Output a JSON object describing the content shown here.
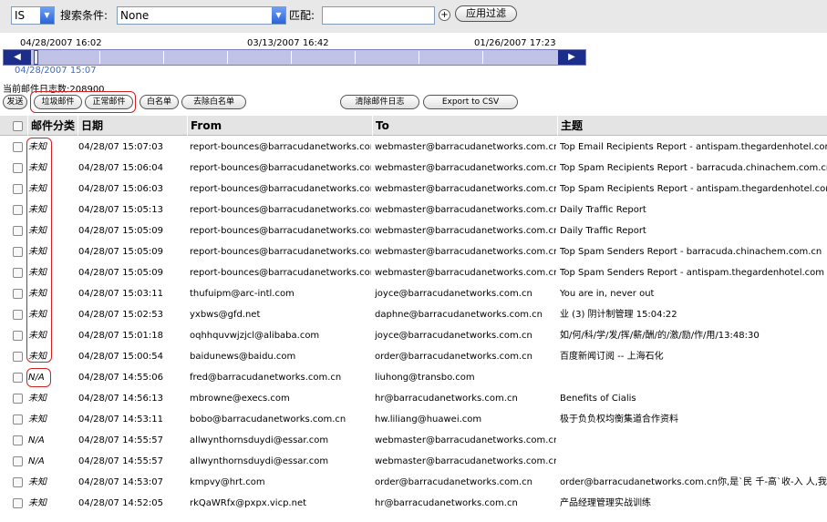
{
  "filter": {
    "field_value": "IS",
    "search_label": "搜索条件:",
    "condition_value": "None",
    "match_label": "匹配:",
    "match_text": "",
    "plus": "+",
    "apply_label": "应用过滤"
  },
  "timeline": {
    "start_date": "04/28/2007 16:02",
    "mid_date": "03/13/2007 16:42",
    "end_date": "01/26/2007 17:23",
    "current": "04/28/2007 15:07",
    "left_arrow": "◀",
    "right_arrow": "▶"
  },
  "total_label": "当前邮件日志数:208900",
  "actions": {
    "send": "发送",
    "spam": "垃圾邮件",
    "normal": "正常邮件",
    "whitelist": "白名单",
    "remove_whitelist": "去除白名单",
    "clear_logs": "清除邮件日志",
    "export": "Export to CSV"
  },
  "columns": {
    "category": "邮件分类",
    "date": "日期",
    "from": "From",
    "to": "To",
    "subject": "主题"
  },
  "rows": [
    {
      "cat": "未知",
      "date": "04/28/07 15:07:03",
      "from": "report-bounces@barracudanetworks.com",
      "to": "webmaster@barracudanetworks.com.cn",
      "subject": "Top Email Recipients Report - antispam.thegardenhotel.com"
    },
    {
      "cat": "未知",
      "date": "04/28/07 15:06:04",
      "from": "report-bounces@barracudanetworks.com",
      "to": "webmaster@barracudanetworks.com.cn",
      "subject": "Top Spam Recipients Report - barracuda.chinachem.com.cn"
    },
    {
      "cat": "未知",
      "date": "04/28/07 15:06:03",
      "from": "report-bounces@barracudanetworks.com",
      "to": "webmaster@barracudanetworks.com.cn",
      "subject": "Top Spam Recipients Report - antispam.thegardenhotel.com"
    },
    {
      "cat": "未知",
      "date": "04/28/07 15:05:13",
      "from": "report-bounces@barracudanetworks.com",
      "to": "webmaster@barracudanetworks.com.cn",
      "subject": "Daily Traffic Report"
    },
    {
      "cat": "未知",
      "date": "04/28/07 15:05:09",
      "from": "report-bounces@barracudanetworks.com",
      "to": "webmaster@barracudanetworks.com.cn",
      "subject": "Daily Traffic Report"
    },
    {
      "cat": "未知",
      "date": "04/28/07 15:05:09",
      "from": "report-bounces@barracudanetworks.com",
      "to": "webmaster@barracudanetworks.com.cn",
      "subject": "Top Spam Senders Report - barracuda.chinachem.com.cn"
    },
    {
      "cat": "未知",
      "date": "04/28/07 15:05:09",
      "from": "report-bounces@barracudanetworks.com",
      "to": "webmaster@barracudanetworks.com.cn",
      "subject": "Top Spam Senders Report - antispam.thegardenhotel.com"
    },
    {
      "cat": "未知",
      "date": "04/28/07 15:03:11",
      "from": "thufuipm@arc-intl.com",
      "to": "joyce@barracudanetworks.com.cn",
      "subject": "You are in, never out"
    },
    {
      "cat": "未知",
      "date": "04/28/07 15:02:53",
      "from": "yxbws@gfd.net",
      "to": "daphne@barracudanetworks.com.cn",
      "subject": "业 (3) 阴计制管理 15:04:22"
    },
    {
      "cat": "未知",
      "date": "04/28/07 15:01:18",
      "from": "oqhhquvwjzjcl@alibaba.com",
      "to": "joyce@barracudanetworks.com.cn",
      "subject": "如/何/科/学/发/挥/薪/酬/的/激/励/作/用/13:48:30"
    },
    {
      "cat": "未知",
      "date": "04/28/07 15:00:54",
      "from": "baidunews@baidu.com",
      "to": "order@barracudanetworks.com.cn",
      "subject": "百度新闻订阅 -- 上海石化"
    },
    {
      "cat": "N/A",
      "date": "04/28/07 14:55:06",
      "from": "fred@barracudanetworks.com.cn",
      "to": "liuhong@transbo.com",
      "subject": ""
    },
    {
      "cat": "未知",
      "date": "04/28/07 14:56:13",
      "from": "mbrowne@execs.com",
      "to": "hr@barracudanetworks.com.cn",
      "subject": "Benefits of Cialis"
    },
    {
      "cat": "未知",
      "date": "04/28/07 14:53:11",
      "from": "bobo@barracudanetworks.com.cn",
      "to": "hw.liliang@huawei.com",
      "subject": "极于负负权均衡集道合作资料"
    },
    {
      "cat": "N/A",
      "date": "04/28/07 14:55:57",
      "from": "allwynthornsduydi@essar.com",
      "to": "webmaster@barracudanetworks.com.cn",
      "subject": ""
    },
    {
      "cat": "N/A",
      "date": "04/28/07 14:55:57",
      "from": "allwynthornsduydi@essar.com",
      "to": "webmaster@barracudanetworks.com.cn",
      "subject": ""
    },
    {
      "cat": "未知",
      "date": "04/28/07 14:53:07",
      "from": "kmpvy@hrt.com",
      "to": "order@barracudanetworks.com.cn",
      "subject": "order@barracudanetworks.com.cn你,是`民 千-高`收-入 人,我"
    },
    {
      "cat": "未知",
      "date": "04/28/07 14:52:05",
      "from": "rkQaWRfx@pxpx.vicp.net",
      "to": "hr@barracudanetworks.com.cn",
      "subject": "产品经理管理实战训练"
    }
  ]
}
